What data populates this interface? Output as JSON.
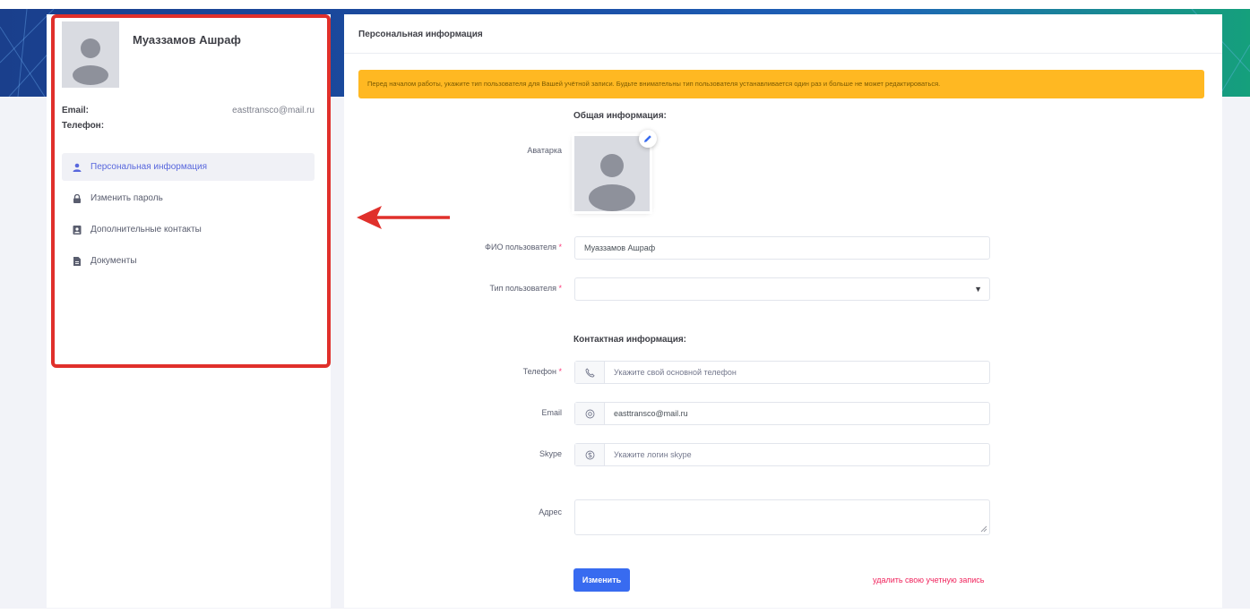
{
  "profile": {
    "name": "Муаззамов Ашраф",
    "email_label": "Email:",
    "email_value": "easttransco@mail.ru",
    "phone_label": "Телефон:",
    "phone_value": ""
  },
  "sidebar": {
    "items": [
      {
        "label": "Персональная информация",
        "icon": "user-icon",
        "active": true
      },
      {
        "label": "Изменить пароль",
        "icon": "lock-icon",
        "active": false
      },
      {
        "label": "Дополнительные контакты",
        "icon": "contact-card-icon",
        "active": false
      },
      {
        "label": "Документы",
        "icon": "document-icon",
        "active": false
      }
    ]
  },
  "main": {
    "title": "Персональная информация",
    "alert": "Перед началом работы, укажите тип пользователя для Вашей учётной записи. Будьте внимательны тип пользователя устанавливается один раз и больше не может редактироваться.",
    "general_title": "Общая информация:",
    "avatar_label": "Аватарка",
    "fio_label": "ФИО пользователя",
    "fio_value": "Муаззамов Ашраф",
    "type_label": "Тип пользователя",
    "type_value": "",
    "contact_title": "Контактная информация:",
    "phone_label": "Телефон",
    "phone_placeholder": "Укажите свой основной телефон",
    "email_label": "Email",
    "email_value": "easttransco@mail.ru",
    "skype_label": "Skype",
    "skype_placeholder": "Укажите логин skype",
    "address_label": "Адрес",
    "address_value": "",
    "submit_label": "Изменить",
    "delete_label": "удалить свою учетную запись",
    "required_mark": "*"
  },
  "colors": {
    "accent": "#5867dd",
    "primary_button": "#386bf0",
    "alert_bg": "#ffb822",
    "highlight_border": "#e0302b",
    "danger": "#f0235c"
  }
}
